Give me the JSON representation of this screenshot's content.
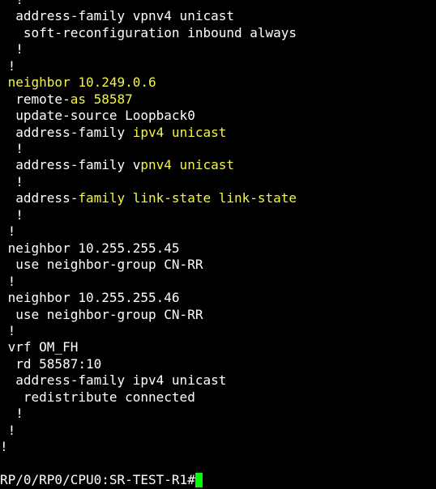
{
  "colors": {
    "background": "#000000",
    "default_text": "#ffffff",
    "highlight_text": "#f5f542",
    "cursor": "#00ff00"
  },
  "terminal": {
    "lines": [
      {
        "segments": [
          {
            "text": "  !",
            "color": "#ffffff"
          }
        ]
      },
      {
        "segments": [
          {
            "text": "  address-family vpnv4 unicast",
            "color": "#ffffff"
          }
        ]
      },
      {
        "segments": [
          {
            "text": "   soft-reconfiguration inbound always",
            "color": "#ffffff"
          }
        ]
      },
      {
        "segments": [
          {
            "text": "  !",
            "color": "#ffffff"
          }
        ]
      },
      {
        "segments": [
          {
            "text": " !",
            "color": "#ffffff"
          }
        ]
      },
      {
        "segments": [
          {
            "text": " neighbor 10.249.0.6",
            "color": "#f5f542"
          }
        ]
      },
      {
        "segments": [
          {
            "text": "  remote-",
            "color": "#ffffff"
          },
          {
            "text": "as 58587",
            "color": "#f5f542"
          }
        ]
      },
      {
        "segments": [
          {
            "text": "  update-source Loopback0",
            "color": "#ffffff"
          }
        ]
      },
      {
        "segments": [
          {
            "text": "  address-family ",
            "color": "#ffffff"
          },
          {
            "text": "ipv4 unicast",
            "color": "#f5f542"
          }
        ]
      },
      {
        "segments": [
          {
            "text": "  !",
            "color": "#ffffff"
          }
        ]
      },
      {
        "segments": [
          {
            "text": "  address-family v",
            "color": "#ffffff"
          },
          {
            "text": "pnv4 unicast",
            "color": "#f5f542"
          }
        ]
      },
      {
        "segments": [
          {
            "text": "  !",
            "color": "#ffffff"
          }
        ]
      },
      {
        "segments": [
          {
            "text": "  address-",
            "color": "#ffffff"
          },
          {
            "text": "family link-state link-state",
            "color": "#f5f542"
          }
        ]
      },
      {
        "segments": [
          {
            "text": "  !",
            "color": "#ffffff"
          }
        ]
      },
      {
        "segments": [
          {
            "text": " !",
            "color": "#ffffff"
          }
        ]
      },
      {
        "segments": [
          {
            "text": " neighbor 10.255.255.45",
            "color": "#ffffff"
          }
        ]
      },
      {
        "segments": [
          {
            "text": "  use neighbor-group CN-RR",
            "color": "#ffffff"
          }
        ]
      },
      {
        "segments": [
          {
            "text": " !",
            "color": "#ffffff"
          }
        ]
      },
      {
        "segments": [
          {
            "text": " neighbor 10.255.255.46",
            "color": "#ffffff"
          }
        ]
      },
      {
        "segments": [
          {
            "text": "  use neighbor-group CN-RR",
            "color": "#ffffff"
          }
        ]
      },
      {
        "segments": [
          {
            "text": " !",
            "color": "#ffffff"
          }
        ]
      },
      {
        "segments": [
          {
            "text": " vrf OM_FH",
            "color": "#ffffff"
          }
        ]
      },
      {
        "segments": [
          {
            "text": "  rd 58587:10",
            "color": "#ffffff"
          }
        ]
      },
      {
        "segments": [
          {
            "text": "  address-family ipv4 unicast",
            "color": "#ffffff"
          }
        ]
      },
      {
        "segments": [
          {
            "text": "   redistribute connected",
            "color": "#ffffff"
          }
        ]
      },
      {
        "segments": [
          {
            "text": "  !",
            "color": "#ffffff"
          }
        ]
      },
      {
        "segments": [
          {
            "text": " !",
            "color": "#ffffff"
          }
        ]
      },
      {
        "segments": [
          {
            "text": "!",
            "color": "#ffffff"
          }
        ]
      }
    ],
    "prompt": "RP/0/RP0/CPU0:SR-TEST-R1#"
  }
}
